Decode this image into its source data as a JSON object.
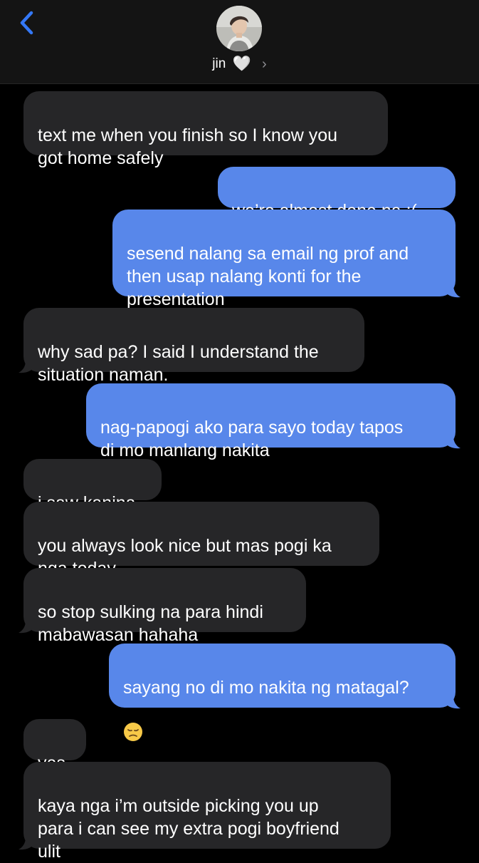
{
  "header": {
    "contact_name": "jin",
    "heart": "🤍",
    "chevron": "›",
    "back_icon": "chevron-left-icon"
  },
  "colors": {
    "incoming_bubble": "#262628",
    "outgoing_bubble": "#5887ea",
    "accent_back": "#3478f6"
  },
  "messages": [
    {
      "from": "them",
      "text": "text me when you finish so I know you\ngot home safely"
    },
    {
      "from": "me",
      "text": "we’re almost done na :("
    },
    {
      "from": "me",
      "text": "sesend nalang sa email ng prof and\nthen usap nalang konti for the\npresentation"
    },
    {
      "from": "them",
      "text": "why sad pa? I said I understand the\nsituation naman."
    },
    {
      "from": "me",
      "text": "nag-papogi ako para sayo today tapos\ndi mo manlang nakita"
    },
    {
      "from": "them",
      "text": "i saw kanina"
    },
    {
      "from": "them",
      "text": "you always look nice but mas pogi ka\nnga today."
    },
    {
      "from": "them",
      "text": "so stop sulking na para hindi\nmabawasan hahaha"
    },
    {
      "from": "me",
      "text": "sayang no di mo nakita ng matagal?"
    },
    {
      "from": "them",
      "text": "yes"
    },
    {
      "from": "them",
      "text": "kaya nga i’m outside picking you up\npara i can see my extra pogi boyfriend\nulit"
    }
  ]
}
